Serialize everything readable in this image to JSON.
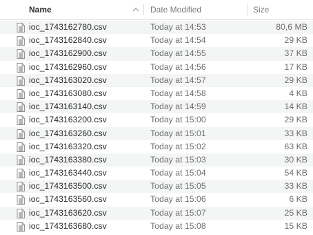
{
  "columns": {
    "name": "Name",
    "date_modified": "Date Modified",
    "size": "Size"
  },
  "files": [
    {
      "name": "ioc_1743162780.csv",
      "date": "Today at 14:53",
      "size": "80,6 MB",
      "icon": "csv-document-icon"
    },
    {
      "name": "ioc_1743162840.csv",
      "date": "Today at 14:54",
      "size": "29 KB",
      "icon": "csv-document-icon"
    },
    {
      "name": "ioc_1743162900.csv",
      "date": "Today at 14:55",
      "size": "37 KB",
      "icon": "csv-document-icon"
    },
    {
      "name": "ioc_1743162960.csv",
      "date": "Today at 14:56",
      "size": "17 KB",
      "icon": "csv-document-icon"
    },
    {
      "name": "ioc_1743163020.csv",
      "date": "Today at 14:57",
      "size": "29 KB",
      "icon": "csv-document-icon"
    },
    {
      "name": "ioc_1743163080.csv",
      "date": "Today at 14:58",
      "size": "4 KB",
      "icon": "csv-document-icon"
    },
    {
      "name": "ioc_1743163140.csv",
      "date": "Today at 14:59",
      "size": "14 KB",
      "icon": "csv-document-icon"
    },
    {
      "name": "ioc_1743163200.csv",
      "date": "Today at 15:00",
      "size": "29 KB",
      "icon": "csv-document-icon"
    },
    {
      "name": "ioc_1743163260.csv",
      "date": "Today at 15:01",
      "size": "33 KB",
      "icon": "csv-document-icon"
    },
    {
      "name": "ioc_1743163320.csv",
      "date": "Today at 15:02",
      "size": "63 KB",
      "icon": "csv-document-icon"
    },
    {
      "name": "ioc_1743163380.csv",
      "date": "Today at 15:03",
      "size": "30 KB",
      "icon": "csv-document-icon"
    },
    {
      "name": "ioc_1743163440.csv",
      "date": "Today at 15:04",
      "size": "54 KB",
      "icon": "csv-document-icon"
    },
    {
      "name": "ioc_1743163500.csv",
      "date": "Today at 15:05",
      "size": "33 KB",
      "icon": "csv-document-icon"
    },
    {
      "name": "ioc_1743163560.csv",
      "date": "Today at 15:06",
      "size": "6 KB",
      "icon": "csv-document-icon"
    },
    {
      "name": "ioc_1743163620.csv",
      "date": "Today at 15:07",
      "size": "25 KB",
      "icon": "csv-document-icon"
    },
    {
      "name": "ioc_1743163680.csv",
      "date": "Today at 15:08",
      "size": "15 KB",
      "icon": "csv-document-icon"
    }
  ],
  "colors": {
    "row_alt_background": "#f4f5f5",
    "header_text": "#7a7a7a",
    "name_text": "#2a2a2a"
  }
}
